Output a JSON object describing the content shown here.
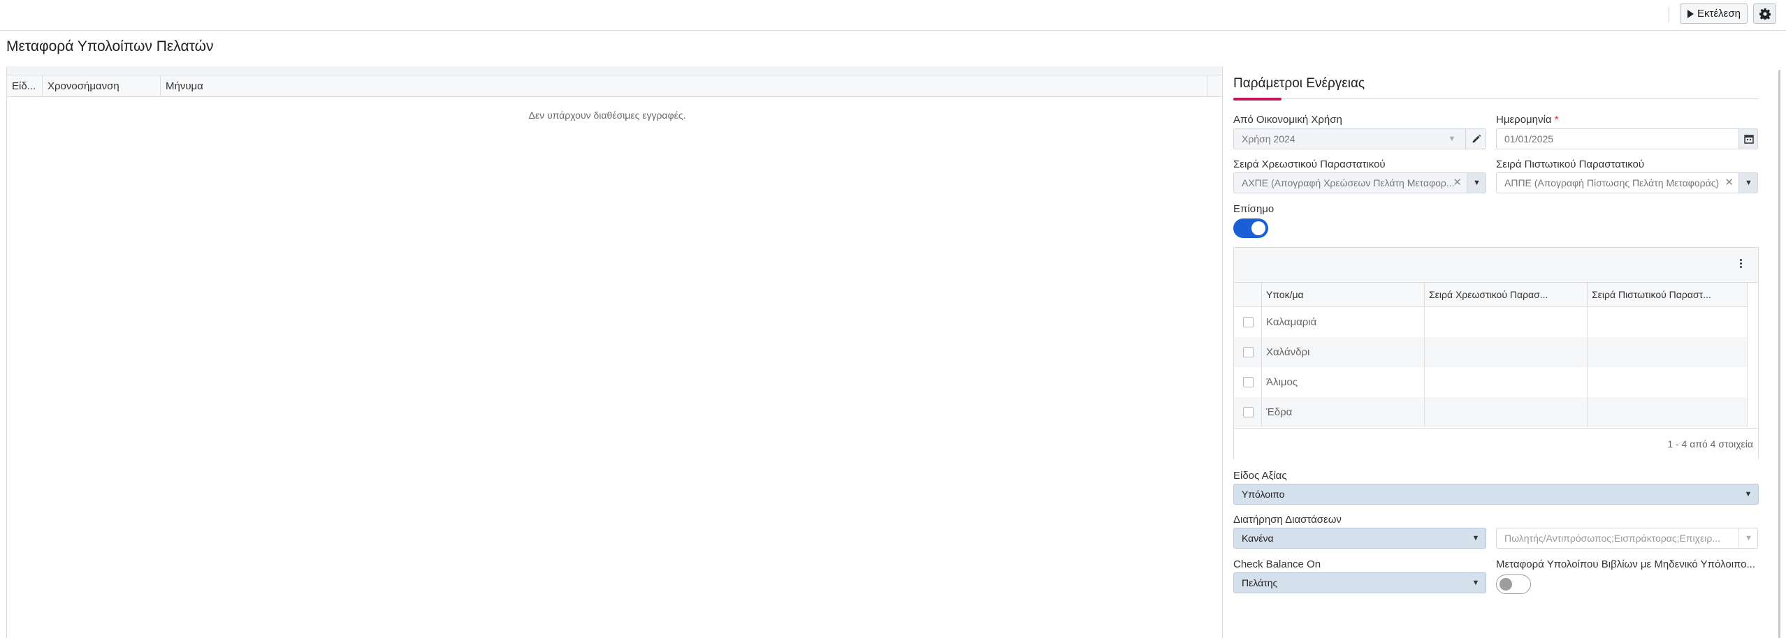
{
  "toolbar": {
    "run_label": "Εκτέλεση"
  },
  "page": {
    "title": "Μεταφορά Υπολοίπων Πελατών"
  },
  "log_grid": {
    "columns": [
      "Είδ...",
      "Χρονοσήμανση",
      "Μήνυμα"
    ],
    "empty_text": "Δεν υπάρχουν διαθέσιμες εγγραφές."
  },
  "params": {
    "title": "Παράμετροι Ενέργειας",
    "fiscal_year": {
      "label": "Από Οικονομική Χρήση",
      "value": "Χρήση 2024"
    },
    "date": {
      "label": "Ημερομηνία",
      "required_mark": "*",
      "value": "01/01/2025"
    },
    "debit_series": {
      "label": "Σειρά Χρεωστικού Παραστατικού",
      "value": "ΑΧΠΕ (Απογραφή Χρεώσεων Πελάτη Μεταφορ..."
    },
    "credit_series": {
      "label": "Σειρά Πιστωτικού Παραστατικού",
      "value": "ΑΠΠΕ (Απογραφή Πίστωσης Πελάτη Μεταφοράς)"
    },
    "official": {
      "label": "Επίσημο",
      "checked": true
    },
    "branches_grid": {
      "columns": [
        "Υποκ/μα",
        "Σειρά Χρεωστικού Παρασ...",
        "Σειρά Πιστωτικού Παραστ..."
      ],
      "rows": [
        {
          "branch": "Καλαμαριά",
          "debit": "",
          "credit": ""
        },
        {
          "branch": "Χαλάνδρι",
          "debit": "",
          "credit": ""
        },
        {
          "branch": "Άλιμος",
          "debit": "",
          "credit": ""
        },
        {
          "branch": "Έδρα",
          "debit": "",
          "credit": ""
        }
      ],
      "pager": "1 - 4 από 4 στοιχεία"
    },
    "value_type": {
      "label": "Είδος Αξίας",
      "value": "Υπόλοιπο"
    },
    "dimensions": {
      "label": "Διατήρηση Διαστάσεων",
      "value": "Κανένα",
      "detail_value": "Πωλητής/Αντιπρόσωπος;Εισπράκτορας;Επιχειρ..."
    },
    "check_balance": {
      "label": "Check Balance On",
      "value": "Πελάτης"
    },
    "zero_balance": {
      "label": "Μεταφορά Υπολοίπου Βιβλίων με Μηδενικό Υπόλοιπο...",
      "checked": false
    }
  },
  "colors": {
    "accent": "#c2185b",
    "toggle_on": "#1a5fd6",
    "select_bg": "#d5e0ed"
  }
}
